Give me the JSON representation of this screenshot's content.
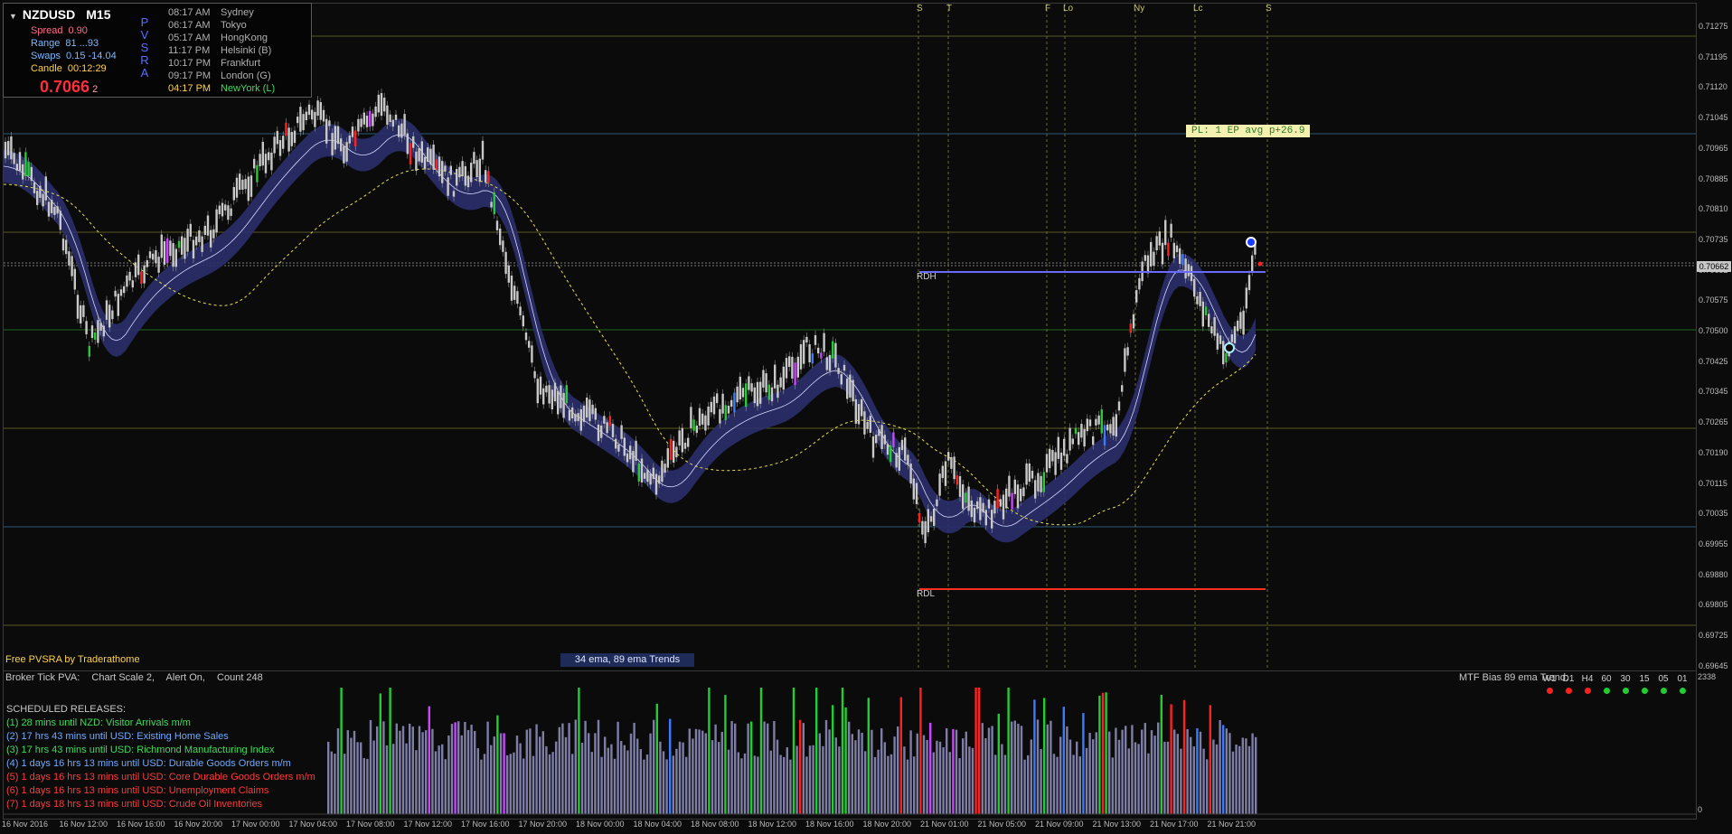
{
  "symbol": "NZDUSD",
  "timeframe": "M15",
  "stats": {
    "spread_label": "Spread",
    "spread_value": "0.90",
    "range_label": "Range",
    "range_value": "81  ...93",
    "swaps_label": "Swaps",
    "swaps_value": "0.15  -14.04",
    "candle_label": "Candle",
    "candle_value": "00:12:29"
  },
  "price_display": {
    "main": "0.7066",
    "sub": "2"
  },
  "pvsra_letters": [
    "P",
    "V",
    "S",
    "R",
    "A"
  ],
  "sessions": [
    {
      "time": "08:17 AM",
      "name": "Sydney",
      "active": false
    },
    {
      "time": "06:17 AM",
      "name": "Tokyo",
      "active": false
    },
    {
      "time": "05:17 AM",
      "name": "HongKong",
      "active": false
    },
    {
      "time": "11:17 PM",
      "name": "Helsinki  (B)",
      "active": false
    },
    {
      "time": "10:17 PM",
      "name": "Frankfurt",
      "active": false
    },
    {
      "time": "09:17 PM",
      "name": "London  (G)",
      "active": false
    },
    {
      "time": "04:17 PM",
      "name": "NewYork  (L)",
      "active": true
    }
  ],
  "session_markers": [
    "S",
    "T",
    "F",
    "Lo",
    "Ny",
    "Lc",
    "S"
  ],
  "price_axis": [
    "0.71275",
    "0.71195",
    "0.71120",
    "0.71045",
    "0.70965",
    "0.70885",
    "0.70810",
    "0.70735",
    "0.70652",
    "0.70575",
    "0.70500",
    "0.70425",
    "0.70345",
    "0.70265",
    "0.70190",
    "0.70115",
    "0.70035",
    "0.69955",
    "0.69880",
    "0.69805",
    "0.69725",
    "0.69645"
  ],
  "current_price_tag": "0.70662",
  "pl_label": "PL: 1 EP avg p+26.9",
  "rdh_label": "RDH",
  "rdl_label": "RDL",
  "footer_left": "Free PVSRA by Traderathome",
  "ema_badge": "34 ema, 89 ema Trends",
  "sub_window": {
    "title": "Broker Tick PVA:",
    "chart_scale": "Chart Scale  2,",
    "alert": "Alert On,",
    "count": "Count  248",
    "axis_top": "2338",
    "axis_zero": "0"
  },
  "mtf": {
    "title": "MTF Bias 89 ema Trend:",
    "columns": [
      {
        "label": "W1",
        "color": "#ff2020"
      },
      {
        "label": "D1",
        "color": "#ff2020"
      },
      {
        "label": "H4",
        "color": "#ff2020"
      },
      {
        "label": "60",
        "color": "#22cc33"
      },
      {
        "label": "30",
        "color": "#22cc33"
      },
      {
        "label": "15",
        "color": "#22cc33"
      },
      {
        "label": "05",
        "color": "#22cc33"
      },
      {
        "label": "01",
        "color": "#22cc33"
      }
    ]
  },
  "releases": {
    "header": "SCHEDULED RELEASES:",
    "items": [
      {
        "text": "(1)  28 mins until NZD: Visitor Arrivals m/m",
        "color": "#3ddc5a"
      },
      {
        "text": "(2)  17 hrs 43 mins until USD: Existing Home Sales",
        "color": "#6fa8ff"
      },
      {
        "text": "(3)  17 hrs 43 mins until USD: Richmond Manufacturing Index",
        "color": "#3ddc5a"
      },
      {
        "text": "(4)  1 days 16 hrs 13 mins until USD: Durable Goods Orders m/m",
        "color": "#6fa8ff"
      },
      {
        "text": "(5)  1 days 16 hrs 13 mins until USD: Core Durable Goods Orders m/m",
        "color": "#ff3a3a"
      },
      {
        "text": "(6)  1 days 16 hrs 13 mins until USD: Unemployment Claims",
        "color": "#ff3a3a"
      },
      {
        "text": "(7)  1 days 18 hrs 13 mins until USD: Crude Oil Inventories",
        "color": "#ff3a3a"
      }
    ]
  },
  "time_axis": [
    "16 Nov 2016",
    "16 Nov 12:00",
    "16 Nov 16:00",
    "16 Nov 20:00",
    "17 Nov 00:00",
    "17 Nov 04:00",
    "17 Nov 08:00",
    "17 Nov 12:00",
    "17 Nov 16:00",
    "17 Nov 20:00",
    "18 Nov 00:00",
    "18 Nov 04:00",
    "18 Nov 08:00",
    "18 Nov 12:00",
    "18 Nov 16:00",
    "18 Nov 20:00",
    "21 Nov 01:00",
    "21 Nov 05:00",
    "21 Nov 09:00",
    "21 Nov 13:00",
    "21 Nov 17:00",
    "21 Nov 21:00"
  ],
  "colors": {
    "bull": "#c8c8c8",
    "climax_bull": "#22cc33",
    "climax_bear": "#ff2020",
    "rising_bull": "#3a7bff",
    "rising_bear": "#cc44ff",
    "ema_band": "#2a2f6a",
    "rdh_line": "#6a6aff",
    "rdl_line": "#ff3020"
  }
}
